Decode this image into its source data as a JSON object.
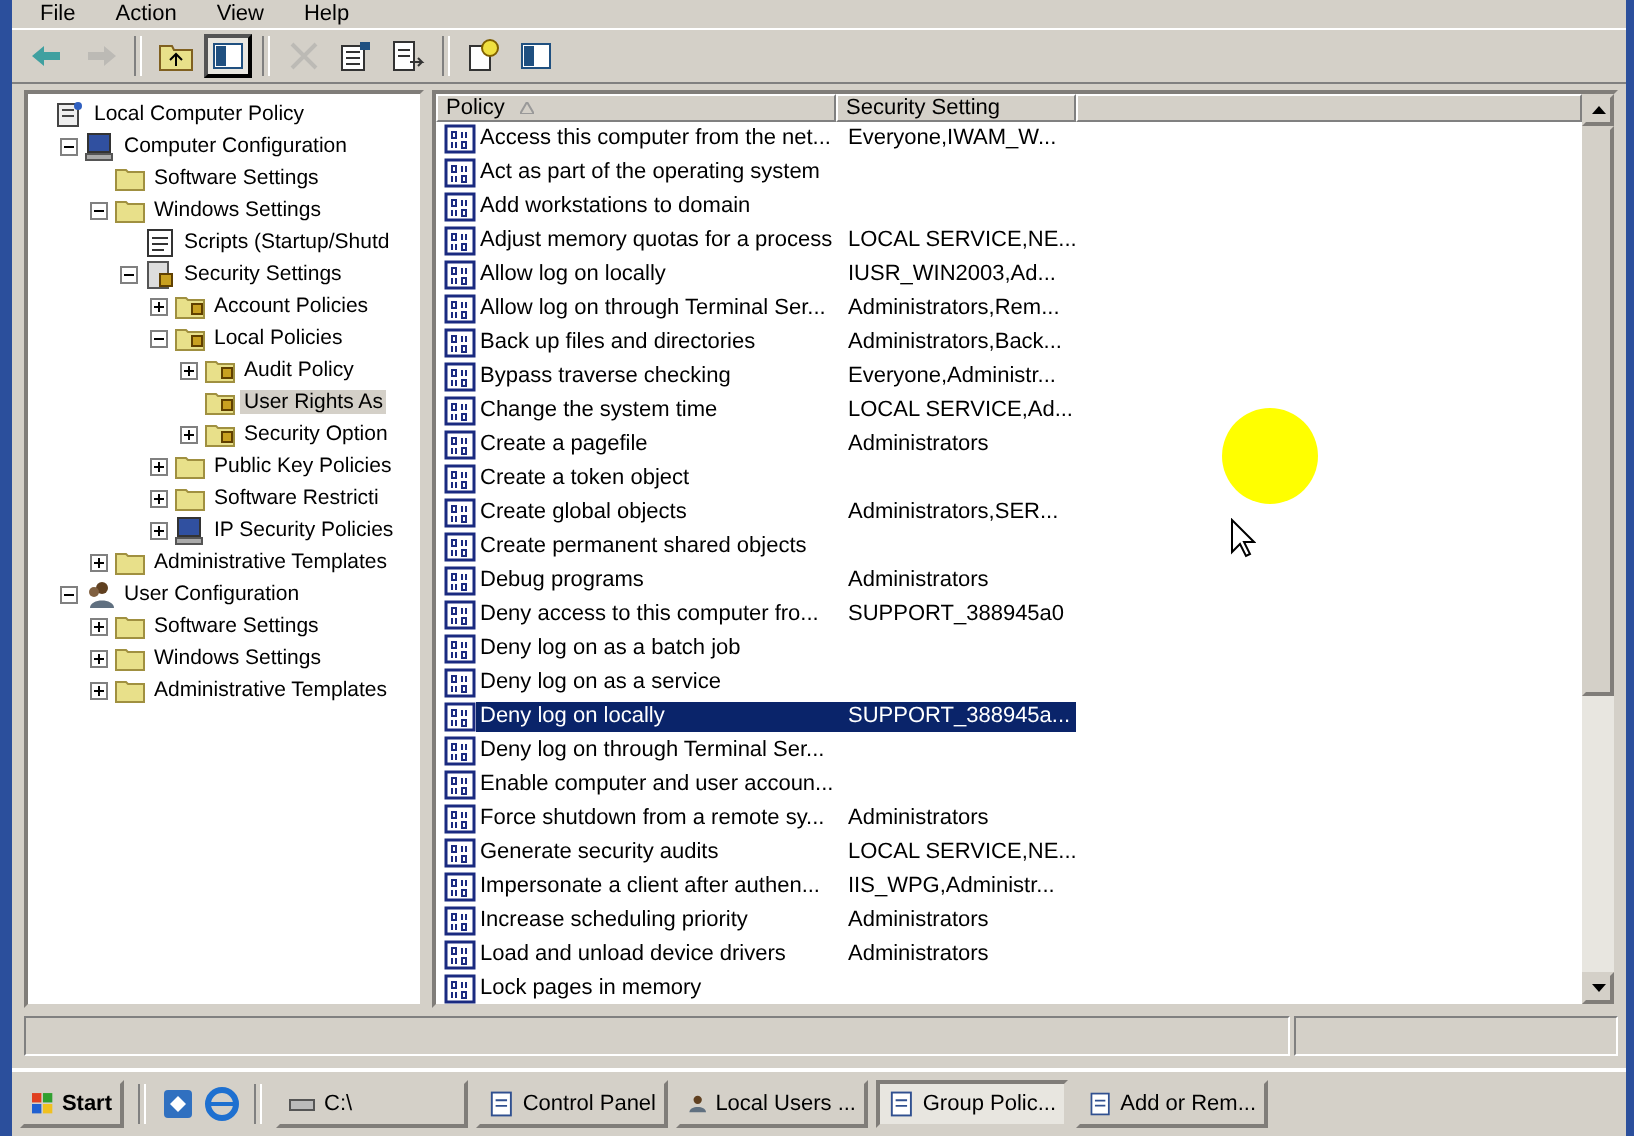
{
  "menu": [
    "File",
    "Action",
    "View",
    "Help"
  ],
  "toolbar": [
    {
      "kind": "back",
      "disabled": false
    },
    {
      "kind": "forward",
      "disabled": true
    },
    {
      "kind": "sep"
    },
    {
      "kind": "up",
      "disabled": false
    },
    {
      "kind": "tree",
      "disabled": false,
      "selected": true
    },
    {
      "kind": "sep"
    },
    {
      "kind": "delete",
      "disabled": true
    },
    {
      "kind": "properties",
      "disabled": false
    },
    {
      "kind": "export",
      "disabled": false
    },
    {
      "kind": "sep"
    },
    {
      "kind": "help",
      "disabled": false
    },
    {
      "kind": "pane",
      "disabled": false
    }
  ],
  "tree": [
    {
      "label": "Local Computer Policy",
      "kind": "policy",
      "selected": false,
      "children": [
        {
          "label": "Computer Configuration",
          "kind": "computer",
          "expanded": true,
          "selected": false,
          "children": [
            {
              "label": "Software Settings",
              "kind": "folder",
              "selected": false
            },
            {
              "label": "Windows Settings",
              "kind": "folder",
              "expanded": true,
              "selected": false,
              "children": [
                {
                  "label": "Scripts (Startup/Shutd",
                  "kind": "script",
                  "selected": false
                },
                {
                  "label": "Security Settings",
                  "kind": "secure",
                  "expanded": true,
                  "selected": false,
                  "children": [
                    {
                      "label": "Account Policies",
                      "kind": "lockfolder",
                      "expanded": false,
                      "selected": false
                    },
                    {
                      "label": "Local Policies",
                      "kind": "lockfolder",
                      "expanded": true,
                      "selected": false,
                      "children": [
                        {
                          "label": "Audit Policy",
                          "kind": "lockfolder",
                          "expanded": false,
                          "selected": false
                        },
                        {
                          "label": "User Rights As",
                          "kind": "lockfolder",
                          "selected": true
                        },
                        {
                          "label": "Security Option",
                          "kind": "lockfolder",
                          "expanded": false,
                          "selected": false
                        }
                      ]
                    },
                    {
                      "label": "Public Key Policies",
                      "kind": "folder",
                      "expanded": false,
                      "selected": false
                    },
                    {
                      "label": "Software Restricti",
                      "kind": "folder",
                      "expanded": false,
                      "selected": false
                    },
                    {
                      "label": "IP Security Policies",
                      "kind": "computer",
                      "expanded": false,
                      "selected": false
                    }
                  ]
                }
              ]
            },
            {
              "label": "Administrative Templates",
              "kind": "folder",
              "expanded": false,
              "selected": false
            }
          ]
        },
        {
          "label": "User Configuration",
          "kind": "user",
          "expanded": true,
          "selected": false,
          "children": [
            {
              "label": "Software Settings",
              "kind": "folder",
              "expanded": false,
              "selected": false
            },
            {
              "label": "Windows Settings",
              "kind": "folder",
              "expanded": false,
              "selected": false
            },
            {
              "label": "Administrative Templates",
              "kind": "folder",
              "expanded": false,
              "selected": false
            }
          ]
        }
      ]
    }
  ],
  "table": {
    "columns": [
      "Policy",
      "Security Setting"
    ],
    "rows": [
      {
        "policy": "Access this computer from the net...",
        "setting": "Everyone,IWAM_W...",
        "selected": false
      },
      {
        "policy": "Act as part of the operating system",
        "selected": false
      },
      {
        "policy": "Add workstations to domain",
        "selected": false
      },
      {
        "policy": "Adjust memory quotas for a process",
        "setting": "LOCAL SERVICE,NE...",
        "selected": false
      },
      {
        "policy": "Allow log on locally",
        "setting": "IUSR_WIN2003,Ad...",
        "selected": false
      },
      {
        "policy": "Allow log on through Terminal Ser...",
        "setting": "Administrators,Rem...",
        "selected": false
      },
      {
        "policy": "Back up files and directories",
        "setting": "Administrators,Back...",
        "selected": false
      },
      {
        "policy": "Bypass traverse checking",
        "setting": "Everyone,Administr...",
        "selected": false
      },
      {
        "policy": "Change the system time",
        "setting": "LOCAL SERVICE,Ad...",
        "selected": false
      },
      {
        "policy": "Create a pagefile",
        "setting": "Administrators",
        "selected": false
      },
      {
        "policy": "Create a token object",
        "selected": false
      },
      {
        "policy": "Create global objects",
        "setting": "Administrators,SER...",
        "selected": false
      },
      {
        "policy": "Create permanent shared objects",
        "selected": false
      },
      {
        "policy": "Debug programs",
        "setting": "Administrators",
        "selected": false
      },
      {
        "policy": "Deny access to this computer fro...",
        "setting": "SUPPORT_388945a0",
        "selected": false
      },
      {
        "policy": "Deny log on as a batch job",
        "selected": false
      },
      {
        "policy": "Deny log on as a service",
        "selected": false
      },
      {
        "policy": "Deny log on locally",
        "setting": "SUPPORT_388945a...",
        "selected": true
      },
      {
        "policy": "Deny log on through Terminal Ser...",
        "selected": false
      },
      {
        "policy": "Enable computer and user accoun...",
        "selected": false
      },
      {
        "policy": "Force shutdown from a remote sy...",
        "setting": "Administrators",
        "selected": false
      },
      {
        "policy": "Generate security audits",
        "setting": "LOCAL SERVICE,NE...",
        "selected": false
      },
      {
        "policy": "Impersonate a client after authen...",
        "setting": "IIS_WPG,Administr...",
        "selected": false
      },
      {
        "policy": "Increase scheduling priority",
        "setting": "Administrators",
        "selected": false
      },
      {
        "policy": "Load and unload device drivers",
        "setting": "Administrators",
        "selected": false
      },
      {
        "policy": "Lock pages in memory",
        "selected": false
      }
    ]
  },
  "taskbar": {
    "start": "Start",
    "tasks": [
      {
        "label": "C:\\",
        "kind": "drive",
        "selected": false
      },
      {
        "label": "Control Panel",
        "kind": "panel",
        "selected": false
      },
      {
        "label": "Local Users ...",
        "kind": "users",
        "selected": false
      },
      {
        "label": "Group Polic...",
        "kind": "policy",
        "selected": true
      },
      {
        "label": "Add or Rem...",
        "kind": "install",
        "selected": false
      }
    ]
  }
}
